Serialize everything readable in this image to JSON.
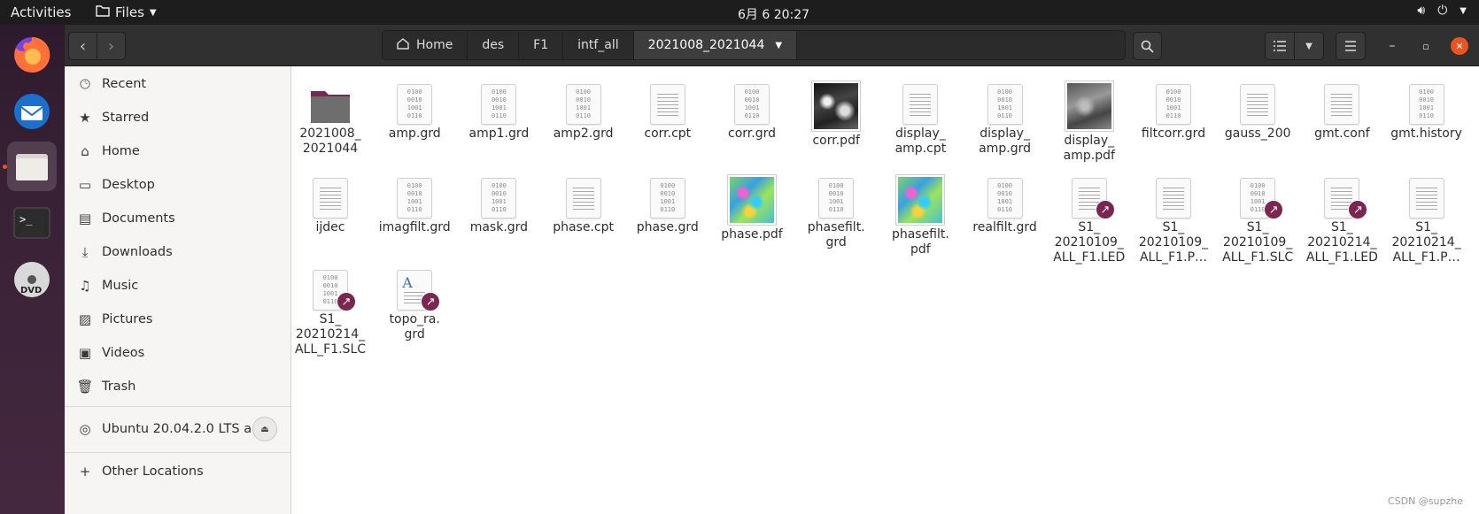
{
  "topbar": {
    "activities": "Activities",
    "app_menu": "Files",
    "clock": "6月 6  20:27"
  },
  "header": {
    "breadcrumbs": [
      "Home",
      "des",
      "F1",
      "intf_all",
      "2021008_2021044"
    ]
  },
  "sidebar": {
    "items": [
      {
        "label": "Recent",
        "icon": "clock-icon"
      },
      {
        "label": "Starred",
        "icon": "star-icon"
      },
      {
        "label": "Home",
        "icon": "home-icon"
      },
      {
        "label": "Desktop",
        "icon": "desktop-icon"
      },
      {
        "label": "Documents",
        "icon": "documents-icon"
      },
      {
        "label": "Downloads",
        "icon": "downloads-icon"
      },
      {
        "label": "Music",
        "icon": "music-icon"
      },
      {
        "label": "Pictures",
        "icon": "pictures-icon"
      },
      {
        "label": "Videos",
        "icon": "videos-icon"
      },
      {
        "label": "Trash",
        "icon": "trash-icon"
      }
    ],
    "device": "Ubuntu 20.04.2.0 LTS a…",
    "other": "Other Locations"
  },
  "files": [
    {
      "label": "2021008_\n2021044",
      "type": "folder"
    },
    {
      "label": "amp.grd",
      "type": "bin"
    },
    {
      "label": "amp1.grd",
      "type": "bin"
    },
    {
      "label": "amp2.grd",
      "type": "bin"
    },
    {
      "label": "corr.cpt",
      "type": "txt"
    },
    {
      "label": "corr.grd",
      "type": "bin"
    },
    {
      "label": "corr.pdf",
      "type": "thumb-gray"
    },
    {
      "label": "display_\namp.cpt",
      "type": "txt"
    },
    {
      "label": "display_\namp.grd",
      "type": "bin"
    },
    {
      "label": "display_\namp.pdf",
      "type": "thumb-gray2"
    },
    {
      "label": "filtcorr.grd",
      "type": "bin"
    },
    {
      "label": "gauss_200",
      "type": "txt"
    },
    {
      "label": "gmt.conf",
      "type": "txt"
    },
    {
      "label": "gmt.history",
      "type": "bin"
    },
    {
      "label": "ijdec",
      "type": "txt"
    },
    {
      "label": "imagfilt.grd",
      "type": "bin"
    },
    {
      "label": "mask.grd",
      "type": "bin"
    },
    {
      "label": "phase.cpt",
      "type": "txt"
    },
    {
      "label": "phase.grd",
      "type": "bin"
    },
    {
      "label": "phase.pdf",
      "type": "thumb-color"
    },
    {
      "label": "phasefilt.\ngrd",
      "type": "bin"
    },
    {
      "label": "phasefilt.\npdf",
      "type": "thumb-color"
    },
    {
      "label": "realfilt.grd",
      "type": "bin"
    },
    {
      "label": "S1_\n20210109_\nALL_F1.LED",
      "type": "txt",
      "link": true
    },
    {
      "label": "S1_\n20210109_\nALL_F1.P…",
      "type": "txt"
    },
    {
      "label": "S1_\n20210109_\nALL_F1.SLC",
      "type": "bin",
      "link": true
    },
    {
      "label": "S1_\n20210214_\nALL_F1.LED",
      "type": "txt",
      "link": true
    },
    {
      "label": "S1_\n20210214_\nALL_F1.P…",
      "type": "txt"
    },
    {
      "label": "S1_\n20210214_\nALL_F1.SLC",
      "type": "bin",
      "link": true
    },
    {
      "label": "topo_ra.\ngrd",
      "type": "doc",
      "link": true
    }
  ],
  "bin_glyph": "0100\n0010\n1001\n0110",
  "watermark": "CSDN @supzhe",
  "colors": {
    "accent": "#e95420",
    "link_badge": "#7a2650",
    "header": "#303030",
    "sidebar": "#f6f5f4"
  }
}
